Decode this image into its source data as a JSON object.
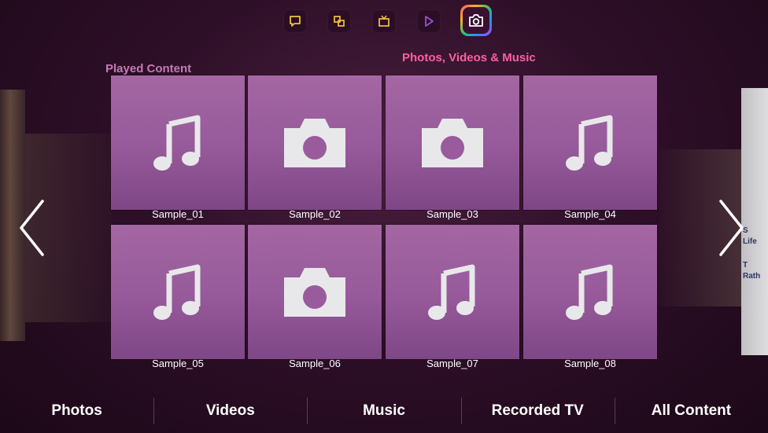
{
  "top_apps": [
    {
      "name": "chat",
      "icon": "speech-bubble-icon",
      "color": "#f3c23a"
    },
    {
      "name": "multi-screen",
      "icon": "multiscreen-icon",
      "color": "#f3c23a"
    },
    {
      "name": "tv",
      "icon": "tv-icon",
      "color": "#f3c23a"
    },
    {
      "name": "play",
      "icon": "play-icon",
      "color": "#9a52d6"
    },
    {
      "name": "photos-videos-music",
      "icon": "camera-icon",
      "color": "#ffffff",
      "active": true
    }
  ],
  "sections": {
    "played_content": "Played Content",
    "current_panel": "Photos, Videos & Music"
  },
  "tiles": [
    {
      "label": "Sample_01",
      "icon": "music-note-icon"
    },
    {
      "label": "Sample_02",
      "icon": "camera-icon"
    },
    {
      "label": "Sample_03",
      "icon": "camera-icon"
    },
    {
      "label": "Sample_04",
      "icon": "music-note-icon"
    },
    {
      "label": "Sample_05",
      "icon": "music-note-icon"
    },
    {
      "label": "Sample_06",
      "icon": "camera-icon"
    },
    {
      "label": "Sample_07",
      "icon": "music-note-icon"
    },
    {
      "label": "Sample_08",
      "icon": "music-note-icon"
    }
  ],
  "right_panel_text": [
    "S",
    "Life",
    "T",
    "Rath"
  ],
  "bottom_menu": [
    "Photos",
    "Videos",
    "Music",
    "Recorded TV",
    "All Content"
  ],
  "colors": {
    "tile": "#9a5b9c",
    "played_label": "#c47ab7",
    "active_label": "#ff5fa0"
  }
}
